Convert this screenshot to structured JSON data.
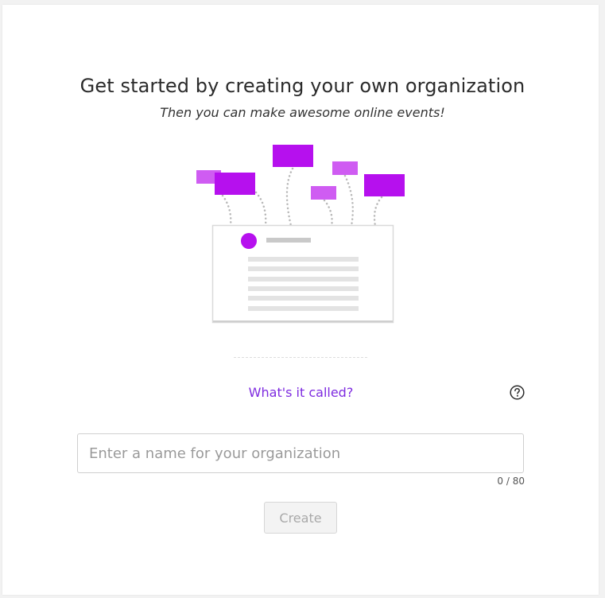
{
  "header": {
    "title": "Get started by creating your own organization",
    "subtitle": "Then you can make awesome online events!"
  },
  "illustration": {
    "icon": "organization-events-illustration",
    "colors": {
      "primary": "#b610ee",
      "secondary": "#cf5cf2",
      "dots": "#b8b8b8",
      "card_border": "#d9d9d9",
      "lines": "#e3e3e3"
    }
  },
  "form": {
    "label": "What's it called?",
    "help_icon": "question-circle-icon",
    "input": {
      "value": "",
      "placeholder": "Enter a name for your organization"
    },
    "counter": "0 / 80",
    "create_label": "Create"
  },
  "theme": {
    "accent": "#7e2be0",
    "disabled_text": "#a9a9a9"
  }
}
